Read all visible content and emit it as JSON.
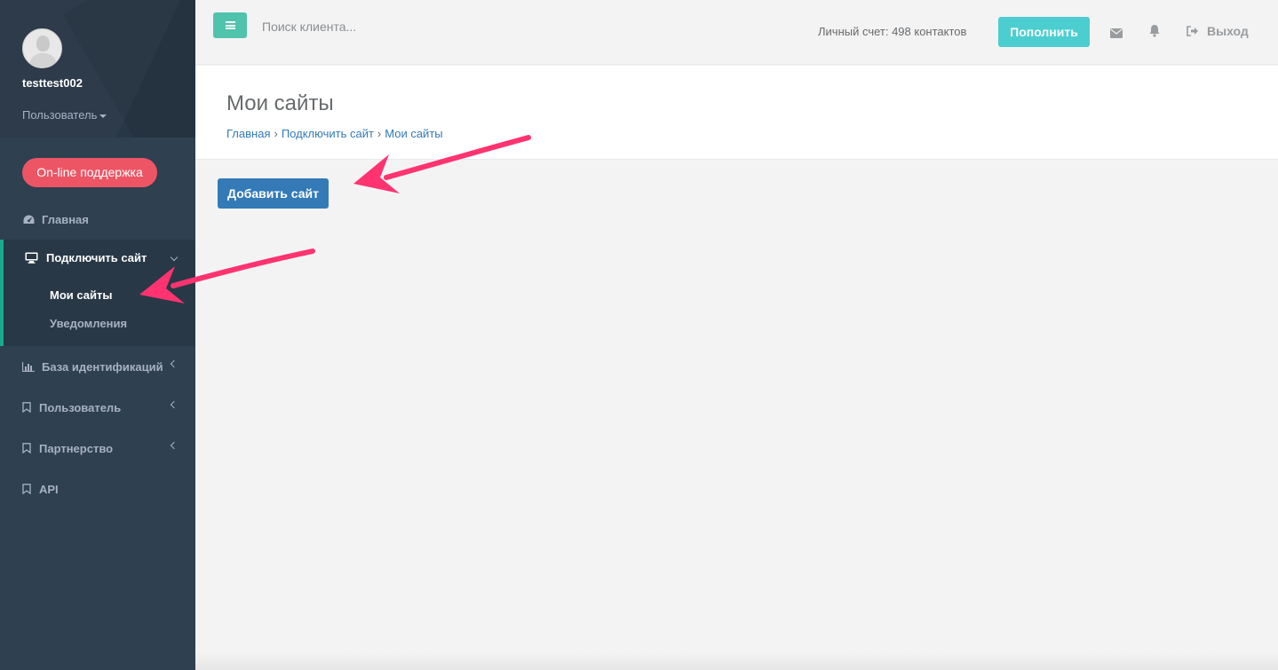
{
  "sidebar": {
    "username": "testtest002",
    "role_label": "Пользователь",
    "support_button": "On-line поддержка",
    "items": [
      {
        "label": "Главная",
        "icon": "dashboard-icon"
      },
      {
        "label": "Подключить сайт",
        "icon": "desktop-icon",
        "expanded": true,
        "children": [
          {
            "label": "Мои сайты",
            "active": true
          },
          {
            "label": "Уведомления",
            "active": false
          }
        ]
      },
      {
        "label": "База идентификаций",
        "icon": "bar-chart-icon"
      },
      {
        "label": "Пользователь",
        "icon": "bookmark-icon"
      },
      {
        "label": "Партнерство",
        "icon": "bookmark-icon"
      },
      {
        "label": "API",
        "icon": "bookmark-icon"
      }
    ]
  },
  "topbar": {
    "search_placeholder": "Поиск клиента...",
    "balance_text": "Личный счет: 498 контактов",
    "topup_label": "Пополнить",
    "logout_label": "Выход"
  },
  "page": {
    "title": "Мои сайты",
    "breadcrumb": [
      "Главная",
      "Подключить сайт",
      "Мои сайты"
    ],
    "breadcrumb_separator": "›",
    "add_site_label": "Добавить сайт"
  },
  "colors": {
    "sidebar_bg": "#2f4050",
    "accent_green": "#1ab394",
    "support_red": "#ed5565",
    "topup_cyan": "#23c6c8",
    "primary_blue": "#337ab7",
    "annotation_arrow": "#ff3370"
  }
}
